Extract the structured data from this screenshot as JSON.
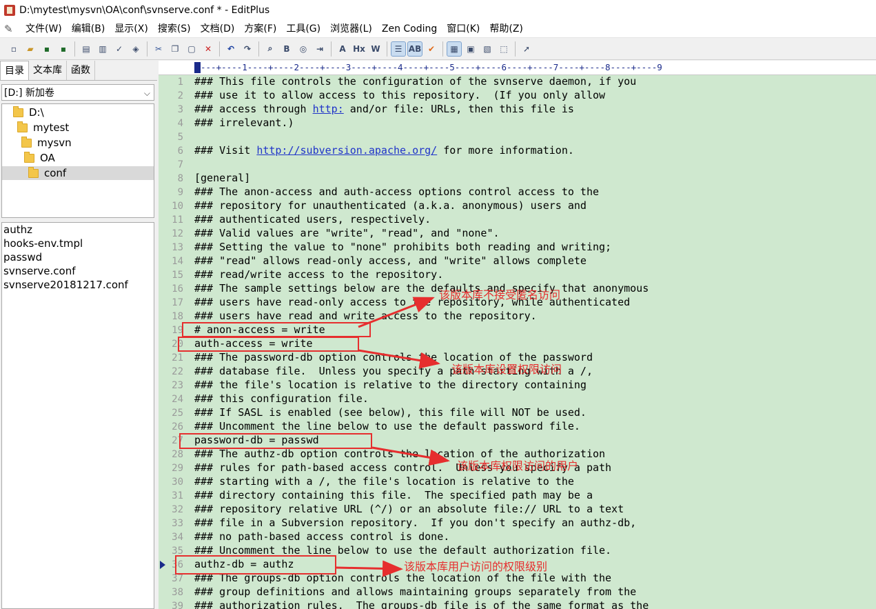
{
  "window": {
    "title": "D:\\mytest\\mysvn\\OA\\conf\\svnserve.conf * - EditPlus"
  },
  "menu": [
    "文件(W)",
    "编辑(B)",
    "显示(X)",
    "搜索(S)",
    "文档(D)",
    "方案(F)",
    "工具(G)",
    "浏览器(L)",
    "Zen Coding",
    "窗口(K)",
    "帮助(Z)"
  ],
  "toolbar": {
    "icons": [
      "new-file-icon",
      "open-folder-icon",
      "save-icon",
      "save-all-icon",
      "sep",
      "print-preview-icon",
      "print-icon",
      "spell-check-icon",
      "browser-preview-icon",
      "sep",
      "cut-icon",
      "copy-icon",
      "paste-icon",
      "delete-icon",
      "sep",
      "undo-icon",
      "redo-icon",
      "sep",
      "find-icon",
      "replace-icon",
      "goto-icon",
      "goto-line-icon",
      "sep",
      "font-icon",
      "heading-icon",
      "word-wrap-icon",
      "sep",
      "ruler-toggle-icon",
      "line-number-toggle-icon",
      "spell-check-toggle-icon",
      "sep",
      "directory-window-icon",
      "cliptext-window-icon",
      "output-window-icon",
      "full-screen-icon",
      "sep",
      "help-cursor-icon"
    ],
    "text_icons": {
      "heading-icon": "Hx",
      "font-icon": "A",
      "word-wrap-icon": "W",
      "line-number-toggle-icon": "AB",
      "replace-icon": "B"
    }
  },
  "sidebar": {
    "tabs": [
      "目录",
      "文本库",
      "函数"
    ],
    "drive": "[D:] 新加卷",
    "tree": [
      "D:\\",
      "mytest",
      "mysvn",
      "OA",
      "conf"
    ],
    "files": [
      "authz",
      "hooks-env.tmpl",
      "passwd",
      "svnserve.conf",
      "svnserve20181217.conf"
    ]
  },
  "ruler": "---+----1----+----2----+----3----+----4----+----5----+----6----+----7----+----8----+----9",
  "code_lines": [
    "### This file controls the configuration of the svnserve daemon, if you",
    "### use it to allow access to this repository.  (If you only allow",
    "### access through http: and/or file: URLs, then this file is",
    "### irrelevant.)",
    "",
    "### Visit http://subversion.apache.org/ for more information.",
    "",
    "[general]",
    "### The anon-access and auth-access options control access to the",
    "### repository for unauthenticated (a.k.a. anonymous) users and",
    "### authenticated users, respectively.",
    "### Valid values are \"write\", \"read\", and \"none\".",
    "### Setting the value to \"none\" prohibits both reading and writing;",
    "### \"read\" allows read-only access, and \"write\" allows complete",
    "### read/write access to the repository.",
    "### The sample settings below are the defaults and specify that anonymous",
    "### users have read-only access to the repository, while authenticated",
    "### users have read and write access to the repository.",
    "# anon-access = write",
    "auth-access = write",
    "### The password-db option controls the location of the password",
    "### database file.  Unless you specify a path starting with a /,",
    "### the file's location is relative to the directory containing",
    "### this configuration file.",
    "### If SASL is enabled (see below), this file will NOT be used.",
    "### Uncomment the line below to use the default password file.",
    "password-db = passwd",
    "### The authz-db option controls the location of the authorization",
    "### rules for path-based access control.  Unless you specify a path",
    "### starting with a /, the file's location is relative to the",
    "### directory containing this file.  The specified path may be a",
    "### repository relative URL (^/) or an absolute file:// URL to a text",
    "### file in a Subversion repository.  If you don't specify an authz-db,",
    "### no path-based access control is done.",
    "### Uncomment the line below to use the default authorization file.",
    "authz-db = authz",
    "### The groups-db option controls the location of the file with the",
    "### group definitions and allows maintaining groups separately from the",
    "### authorization rules.  The groups-db file is of the same format as the"
  ],
  "links": {
    "line3": "http:",
    "line6": "http://subversion.apache.org/"
  },
  "annotations": [
    "该版本库不接受匿名访问",
    "该版本库设置权限访问",
    "该版本库权限访问的用户",
    "该版本库用户访问的权限级别"
  ],
  "colors": {
    "editor_bg": "#cfe8cf",
    "annotation": "#e62e2e",
    "link": "#1f33c9"
  }
}
